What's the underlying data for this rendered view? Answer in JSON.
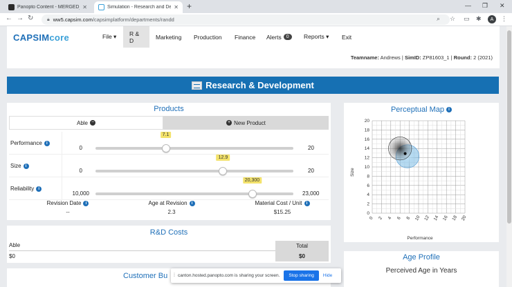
{
  "browser": {
    "tabs": [
      {
        "title": "Panopto Content - MERGED_BSA",
        "active": false
      },
      {
        "title": "Simulation - Research and Deve",
        "active": true
      }
    ],
    "url_host": "ww5.capsim.com",
    "url_path": "/capsimplatform/departments/randd",
    "avatar": "A"
  },
  "app": {
    "logo_main": "CAPSIM",
    "logo_core": "core",
    "nav": [
      {
        "label": "File ▾"
      },
      {
        "label": "R & D"
      },
      {
        "label": "Marketing"
      },
      {
        "label": "Production"
      },
      {
        "label": "Finance"
      },
      {
        "label": "Alerts",
        "badge": "0"
      },
      {
        "label": "Reports ▾"
      },
      {
        "label": "Exit"
      }
    ],
    "team": {
      "teamname_label": "Teamname:",
      "teamname": "Andrews",
      "simid_label": "SimID:",
      "simid": "ZP81603_1",
      "round_label": "Round:",
      "round": "2 (2021)"
    }
  },
  "banner_title": "Research & Development",
  "products": {
    "title": "Products",
    "tab_able": "Able",
    "tab_new": "New Product",
    "sliders": [
      {
        "label": "Performance",
        "min": "0",
        "max": "20",
        "value_label": "7.1",
        "fraction": 0.355
      },
      {
        "label": "Size",
        "min": "0",
        "max": "20",
        "value_label": "12.9",
        "fraction": 0.645
      },
      {
        "label": "Reliability",
        "min": "10,000",
        "max": "23,000",
        "value_label": "20,300",
        "fraction": 0.792
      }
    ],
    "stats": [
      {
        "label": "Revision Date",
        "value": "--"
      },
      {
        "label": "Age at Revision",
        "value": "2.3"
      },
      {
        "label": "Material Cost / Unit",
        "value": "$15.25"
      }
    ]
  },
  "costs": {
    "title": "R&D Costs",
    "row_name": "Able",
    "col_header": "Total",
    "row_value_left": "$0",
    "row_value_total": "$0"
  },
  "customer_title": "Customer Bu",
  "perceptual_map": {
    "title": "Perceptual Map",
    "xlabel": "Performance",
    "ylabel": "Size",
    "ticks": [
      "0",
      "2",
      "4",
      "6",
      "8",
      "10",
      "12",
      "14",
      "16",
      "18",
      "20"
    ],
    "y_ticks": [
      "20",
      "18",
      "16",
      "14",
      "12",
      "10",
      "8",
      "6",
      "4",
      "2",
      "0"
    ],
    "product_point": {
      "x": 7.1,
      "y": 12.9
    }
  },
  "age_profile": {
    "title": "Age Profile",
    "subtitle": "Perceived Age in Years"
  },
  "sharing": {
    "text": "canton.hosted.panopto.com is sharing your screen.",
    "stop": "Stop sharing",
    "hide": "Hide"
  }
}
